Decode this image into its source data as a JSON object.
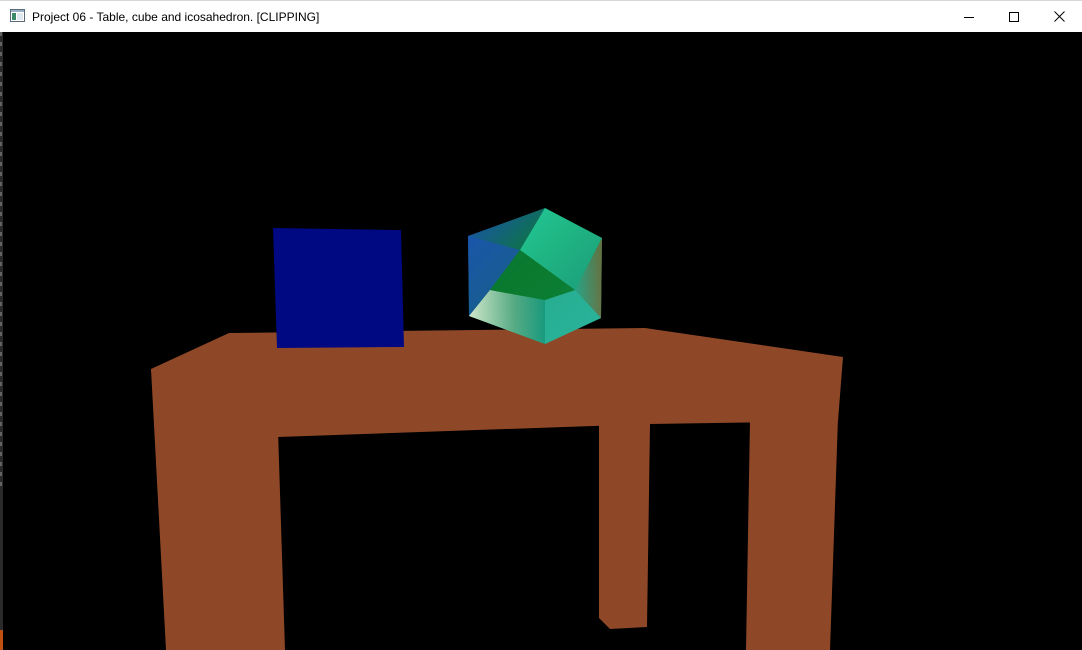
{
  "window": {
    "title": "Project 06 - Table, cube and icosahedron. [CLIPPING]",
    "app_icon": "window-app-icon",
    "controls": {
      "minimize_icon": "minimize-icon",
      "maximize_icon": "maximize-icon",
      "close_icon": "close-icon"
    }
  },
  "scene": {
    "background_color": "#000000",
    "objects": [
      {
        "name": "table",
        "color": "#8f4827"
      },
      {
        "name": "cube",
        "color": "#000882"
      },
      {
        "name": "icosahedron",
        "colors": [
          "#20c890",
          "#0a7a2e",
          "#1a50b0",
          "#e8f0d8",
          "#28b0a0",
          "#7a6a40"
        ]
      }
    ]
  }
}
